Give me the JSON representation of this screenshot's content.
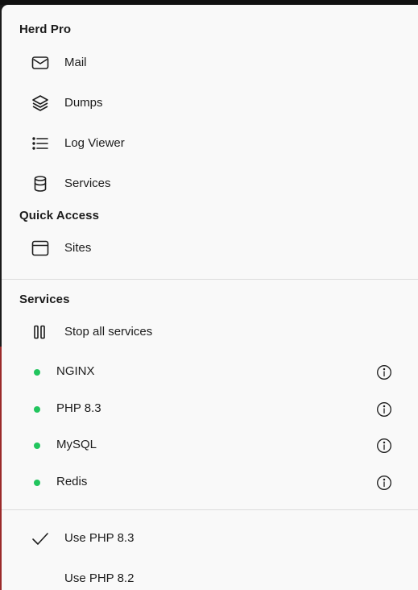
{
  "herd_pro": {
    "title": "Herd Pro",
    "items": [
      {
        "label": "Mail",
        "icon": "mail-icon"
      },
      {
        "label": "Dumps",
        "icon": "layers-icon"
      },
      {
        "label": "Log Viewer",
        "icon": "list-icon"
      },
      {
        "label": "Services",
        "icon": "database-icon"
      }
    ]
  },
  "quick_access": {
    "title": "Quick Access",
    "items": [
      {
        "label": "Sites",
        "icon": "window-icon"
      }
    ]
  },
  "services": {
    "title": "Services",
    "stop_all_label": "Stop all services",
    "list": [
      {
        "name": "NGINX",
        "status_color": "#22c55e"
      },
      {
        "name": "PHP 8.3",
        "status_color": "#22c55e"
      },
      {
        "name": "MySQL",
        "status_color": "#22c55e"
      },
      {
        "name": "Redis",
        "status_color": "#22c55e"
      }
    ]
  },
  "php_versions": [
    {
      "label": "Use PHP 8.3",
      "checked": true
    },
    {
      "label": "Use PHP 8.2",
      "checked": false
    }
  ]
}
